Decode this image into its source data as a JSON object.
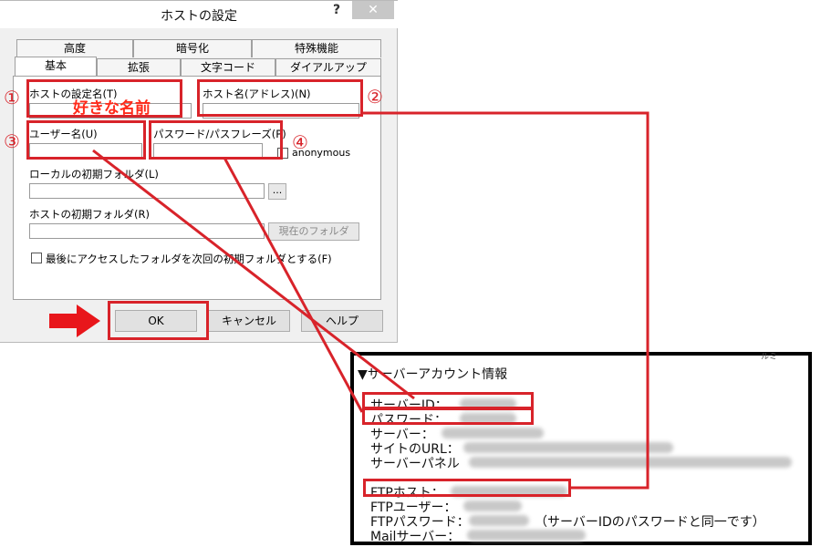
{
  "dialog": {
    "title": "ホストの設定",
    "help": "?",
    "close": "✕",
    "tabs_back": [
      "高度",
      "暗号化",
      "特殊機能"
    ],
    "tabs_front": [
      "基本",
      "拡張",
      "文字コード",
      "ダイアルアップ"
    ],
    "labels": {
      "host_setting_name": "ホストの設定名(T)",
      "host_name": "ホスト名(アドレス)(N)",
      "username": "ユーザー名(U)",
      "password": "パスワード/パスフレーズ(P)",
      "anonymous": "anonymous",
      "local_folder": "ローカルの初期フォルダ(L)",
      "host_folder": "ホストの初期フォルダ(R)",
      "browse": "...",
      "current_folder": "現在のフォルダ",
      "last_folder": "最後にアクセスしたフォルダを次回の初期フォルダとする(F)"
    },
    "buttons": {
      "ok": "OK",
      "cancel": "キャンセル",
      "help": "ヘルプ"
    }
  },
  "annotations": {
    "markers": [
      "①",
      "②",
      "③",
      "④"
    ],
    "host_name_note": "好きな名前",
    "arrow_color": "#d8232a"
  },
  "info_box": {
    "title": "▼サーバーアカウント情報",
    "corner_mark": "ルミ",
    "lines": {
      "server_id": "サーバーID：",
      "password": "パスワード：",
      "server": "サーバー：",
      "site_url": "サイトのURL：",
      "server_panel": "サーバーパネル",
      "ftp_host": "FTPホスト：",
      "ftp_user": "FTPユーザー：",
      "ftp_password": "FTPパスワード：",
      "ftp_password_note": "（サーバーIDのパスワードと同一です）",
      "mail_server": "Mailサーバー："
    }
  }
}
